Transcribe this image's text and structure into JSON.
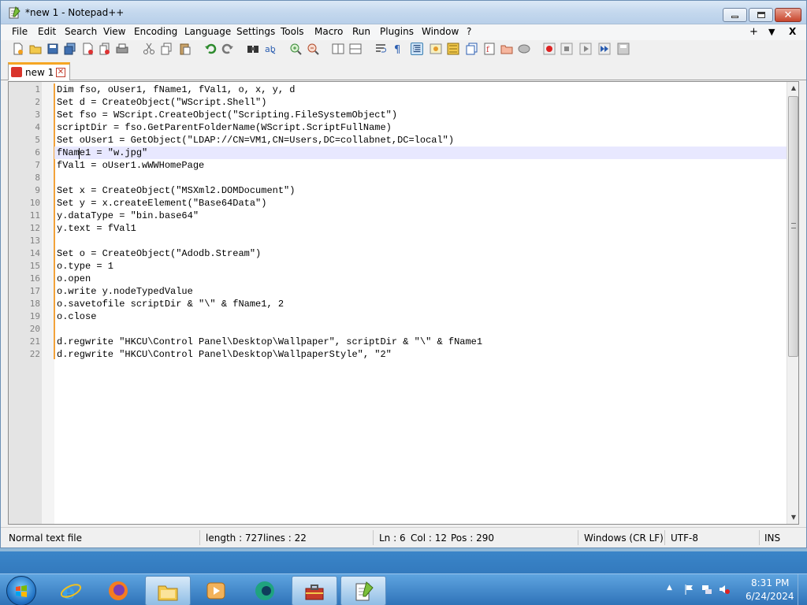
{
  "window": {
    "title": "*new 1 - Notepad++"
  },
  "menu": {
    "items": [
      "File",
      "Edit",
      "Search",
      "View",
      "Encoding",
      "Language",
      "Settings",
      "Tools",
      "Macro",
      "Run",
      "Plugins",
      "Window",
      "?"
    ],
    "right_plus": "+",
    "right_arrow": "▼",
    "right_close": "X"
  },
  "tabs": [
    {
      "label": "new 1",
      "modified": true
    }
  ],
  "editor": {
    "current_line": 6,
    "lines": [
      "Dim fso, oUser1, fName1, fVal1, o, x, y, d",
      "Set d = CreateObject(\"WScript.Shell\")",
      "Set fso = WScript.CreateObject(\"Scripting.FileSystemObject\")",
      "scriptDir = fso.GetParentFolderName(WScript.ScriptFullName)",
      "Set oUser1 = GetObject(\"LDAP://CN=VM1,CN=Users,DC=collabnet,DC=local\")",
      "fName1 = \"w.jpg\"",
      "fVal1 = oUser1.wWWHomePage",
      "",
      "Set x = CreateObject(\"MSXml2.DOMDocument\")",
      "Set y = x.createElement(\"Base64Data\")",
      "y.dataType = \"bin.base64\"",
      "y.text = fVal1",
      "",
      "Set o = CreateObject(\"Adodb.Stream\")",
      "o.type = 1",
      "o.open",
      "o.write y.nodeTypedValue",
      "o.savetofile scriptDir & \"\\\" & fName1, 2",
      "o.close",
      "",
      "d.regwrite \"HKCU\\Control Panel\\Desktop\\Wallpaper\", scriptDir & \"\\\" & fName1",
      "d.regwrite \"HKCU\\Control Panel\\Desktop\\WallpaperStyle\", \"2\""
    ]
  },
  "status": {
    "file_type": "Normal text file",
    "length": "length : 727",
    "lines": "lines : 22",
    "ln": "Ln : 6",
    "col": "Col : 12",
    "pos": "Pos : 290",
    "eol": "Windows (CR LF)",
    "encoding": "UTF-8",
    "mode": "INS"
  },
  "taskbar": {
    "time": "8:31 PM",
    "date": "6/24/2024",
    "apps": [
      "internet-explorer",
      "firefox",
      "file-explorer",
      "media-player",
      "edge-like-browser",
      "toolbox-app",
      "notepad-plus-plus"
    ]
  },
  "colors": {
    "title_bar": "#c4d8ee",
    "change_history": "#f2a23a",
    "current_line": "#e8e8ff",
    "taskbar": "#2f73b8"
  }
}
